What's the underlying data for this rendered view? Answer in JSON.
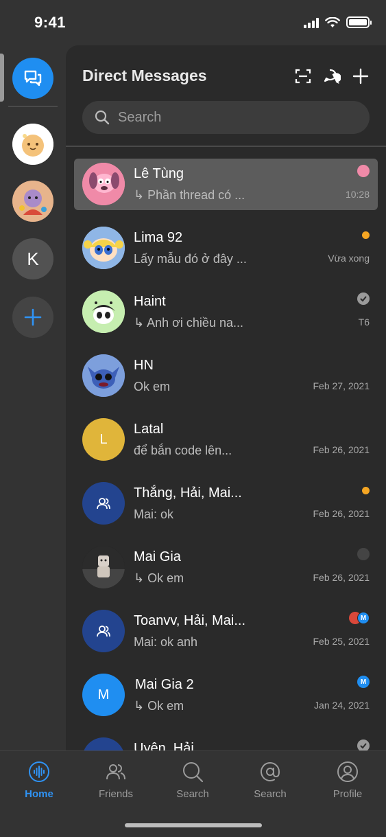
{
  "status_bar": {
    "time": "9:41"
  },
  "rail": {
    "items": [
      {
        "kind": "direct-messages",
        "icon": "chat-icon",
        "active": true
      },
      {
        "kind": "community",
        "icon": "community-avatar-1"
      },
      {
        "kind": "community",
        "icon": "community-avatar-2"
      },
      {
        "kind": "community",
        "letter": "K"
      },
      {
        "kind": "add",
        "icon": "plus-icon"
      }
    ]
  },
  "header": {
    "title": "Direct Messages",
    "actions": [
      "scan-icon",
      "new-chat-icon",
      "plus-icon"
    ]
  },
  "search": {
    "placeholder": "Search"
  },
  "conversations": [
    {
      "name": "Lê Tùng",
      "preview": "↳ Phần thread có ...",
      "time": "10:28",
      "indicator": "mini-avatar",
      "active": true,
      "avatar_color": "#f08aa8"
    },
    {
      "name": "Lima 92",
      "preview": "Lấy mẫu đó ở đây ...",
      "time": "Vừa xong",
      "indicator": "unread-dot",
      "avatar_color": "#8fb6e6"
    },
    {
      "name": "Haint",
      "preview": "↳ Anh ơi chiều na...",
      "time": "T6",
      "indicator": "read-check",
      "avatar_color": "#c6eeb0"
    },
    {
      "name": "HN",
      "preview": "Ok em",
      "time": "Feb 27, 2021",
      "indicator": "",
      "avatar_color": "#4b6fc0"
    },
    {
      "name": "Latal",
      "preview": "để bắn code lên...",
      "time": "Feb 26, 2021",
      "indicator": "",
      "avatar_letter": "L",
      "avatar_color": "#e0b53a"
    },
    {
      "name": "Thắng, Hải, Mai...",
      "preview": "Mai: ok",
      "time": "Feb 26, 2021",
      "indicator": "unread-dot",
      "group": true,
      "avatar_color": "#23448f"
    },
    {
      "name": "Mai Gia",
      "preview": "↳ Ok em",
      "time": "Feb 26, 2021",
      "indicator": "mini-avatar",
      "avatar_color": "#1c1c1c"
    },
    {
      "name": "Toanvv, Hải, Mai...",
      "preview": "Mai: ok anh",
      "time": "Feb 25, 2021",
      "indicator": "mini-avatars",
      "group": true,
      "avatar_color": "#23448f"
    },
    {
      "name": "Mai Gia 2",
      "preview": "↳ Ok em",
      "time": "Jan 24, 2021",
      "indicator": "mini-m",
      "avatar_letter": "M",
      "avatar_color": "#1f8ef1"
    },
    {
      "name": "Uyên, Hải,",
      "preview": "",
      "time": "",
      "indicator": "read-check",
      "group": true,
      "avatar_color": "#23448f"
    }
  ],
  "tabbar": {
    "tabs": [
      {
        "label": "Home",
        "icon": "waveform-icon",
        "active": true
      },
      {
        "label": "Friends",
        "icon": "friends-icon"
      },
      {
        "label": "Search",
        "icon": "search-icon"
      },
      {
        "label": "Search",
        "icon": "at-icon"
      },
      {
        "label": "Profile",
        "icon": "profile-icon"
      }
    ]
  }
}
